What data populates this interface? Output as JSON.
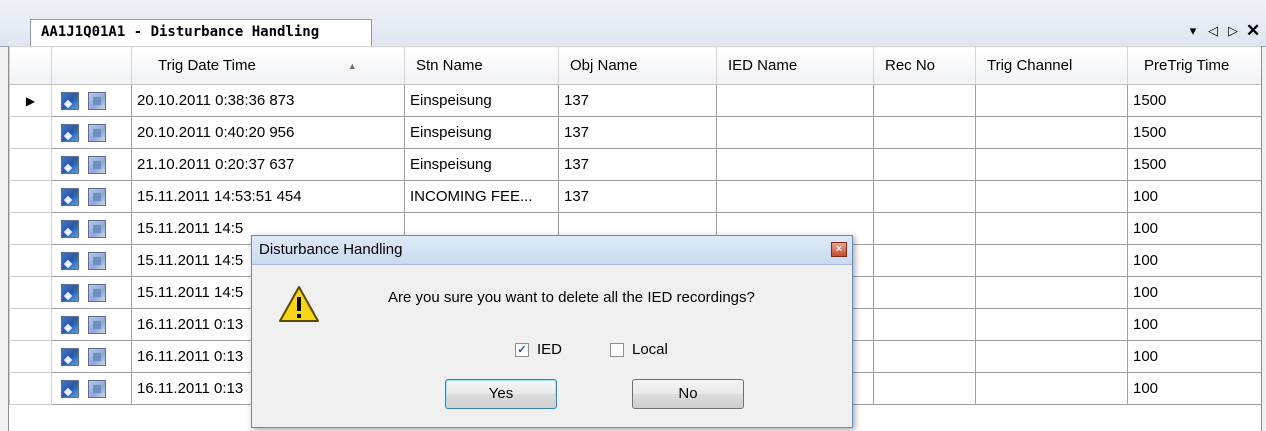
{
  "window": {
    "tab_title": "AA1J1Q01A1 - Disturbance Handling",
    "controls": [
      "▾",
      "◁",
      "▷",
      "✕"
    ]
  },
  "grid": {
    "columns": [
      "Trig Date Time",
      "Stn Name",
      "Obj Name",
      "IED Name",
      "Rec No",
      "Trig Channel",
      "PreTrig Time"
    ],
    "sort_indicator": "▲",
    "current_row_marker": "▶",
    "rows": [
      [
        "20.10.2011 0:38:36 873",
        "Einspeisung",
        "137",
        "",
        "",
        "",
        "1500"
      ],
      [
        "20.10.2011 0:40:20 956",
        "Einspeisung",
        "137",
        "",
        "",
        "",
        "1500"
      ],
      [
        "21.10.2011 0:20:37 637",
        "Einspeisung",
        "137",
        "",
        "",
        "",
        "1500"
      ],
      [
        "15.11.2011 14:53:51 454",
        "INCOMING FEE...",
        "137",
        "",
        "",
        "",
        "100"
      ],
      [
        "15.11.2011 14:5",
        "",
        "",
        "",
        "",
        "",
        "100"
      ],
      [
        "15.11.2011 14:5",
        "",
        "",
        "",
        "",
        "",
        "100"
      ],
      [
        "15.11.2011 14:5",
        "",
        "",
        "",
        "",
        "",
        "100"
      ],
      [
        "16.11.2011 0:13",
        "",
        "",
        "",
        "",
        "",
        "100"
      ],
      [
        "16.11.2011 0:13",
        "",
        "",
        "",
        "",
        "",
        "100"
      ],
      [
        "16.11.2011 0:13",
        "",
        "",
        "",
        "",
        "",
        "100"
      ]
    ]
  },
  "dialog": {
    "title": "Disturbance Handling",
    "message": "Are you sure you want to delete all the IED recordings?",
    "checkbox_ied": {
      "label": "IED",
      "checked": true
    },
    "checkbox_local": {
      "label": "Local",
      "checked": false
    },
    "yes_label": "Yes",
    "no_label": "No"
  },
  "colors": {
    "dialog_border": "#6d8bb8",
    "title_bar": "#c9daf0",
    "warning_yellow": "#f7d417"
  }
}
